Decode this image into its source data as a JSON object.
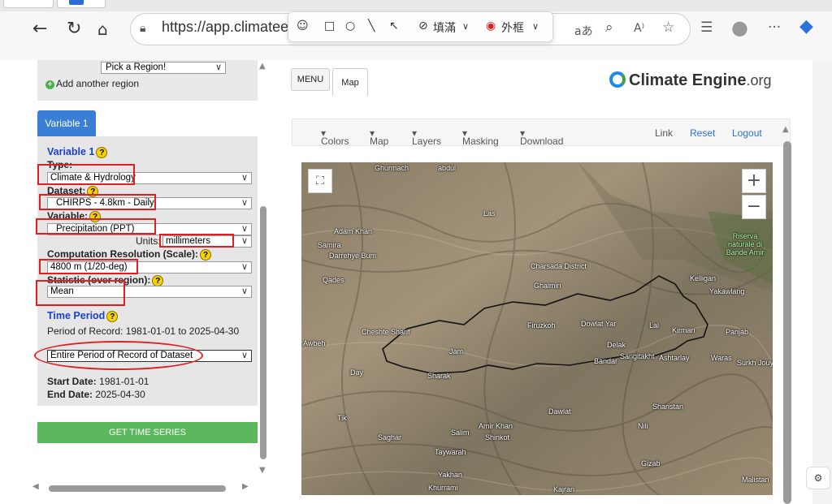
{
  "browser": {
    "url": "https://app.climateengine.org/climateEngine",
    "draw_toolbar": {
      "fill_label": "填滿",
      "border_label": "外框"
    }
  },
  "sidebar": {
    "region_select": "Pick a Region!",
    "add_region": "Add another region",
    "variable_tab": "Variable 1",
    "variable_heading": "Variable 1",
    "type_label": "Type:",
    "type_value": "Climate & Hydrology",
    "dataset_label": "Dataset:",
    "dataset_value": "CHIRPS - 4.8km - Daily",
    "variable_label": "Variable:",
    "variable_value": "Precipitation (PPT)",
    "units_label": "Units:",
    "units_value": "millimeters",
    "resolution_label": "Computation Resolution (Scale):",
    "resolution_value": "4800 m (1/20-deg)",
    "statistic_label": "Statistic (over region):",
    "statistic_value": "Mean",
    "time_period_heading": "Time Period",
    "period_of_record": "Period of Record: 1981-01-01 to 2025-04-30",
    "time_period_select": "Entire Period of Record of Dataset",
    "start_label": "Start Date:",
    "start_value": "1981-01-01",
    "end_label": "End Date:",
    "end_value": "2025-04-30",
    "get_time_series": "GET TIME SERIES",
    "help_glyph": "?"
  },
  "main": {
    "menu_button": "MENU",
    "map_tab": "Map",
    "logo_text": "Climate Engine",
    "logo_suffix": ".org",
    "nav": {
      "colors": "Colors",
      "map": "Map",
      "layers": "Layers",
      "masking": "Masking",
      "download": "Download",
      "link": "Link",
      "reset": "Reset",
      "logout": "Logout"
    },
    "zoom_in": "+",
    "zoom_out": "−",
    "map_labels": [
      "Adam Khan",
      "Samira",
      "Darrehye Bum",
      "Qades",
      "Las",
      "Charsada District",
      "Ghalmin",
      "Dowlat Yar",
      "Lal",
      "Kirman",
      "Delak",
      "Bandar",
      "Sangitakht",
      "Ashtarlay",
      "Cheshte Sharif",
      "Jam",
      "Day",
      "Sharak",
      "Awbeh",
      "Kelligan",
      "Yakawlang",
      "Panjab",
      "Waras",
      "Surkh Jouy",
      "Dawlat",
      "Sharistan",
      "Tik",
      "Saghar",
      "Salim",
      "Amir Khan",
      "Shinkot",
      "Nili",
      "Taywarah",
      "Yakhan",
      "Khurrami",
      "Kajran",
      "Gizab",
      "Malistan",
      "Riserva naturale di Bande Amir",
      "Ghurmach",
      "abdul",
      "Firuzkoh"
    ]
  },
  "colors": {
    "accent_blue": "#3a7fd5",
    "button_green": "#5cb85c",
    "annotation_red": "#e02020",
    "help_yellow": "#f5d200"
  }
}
